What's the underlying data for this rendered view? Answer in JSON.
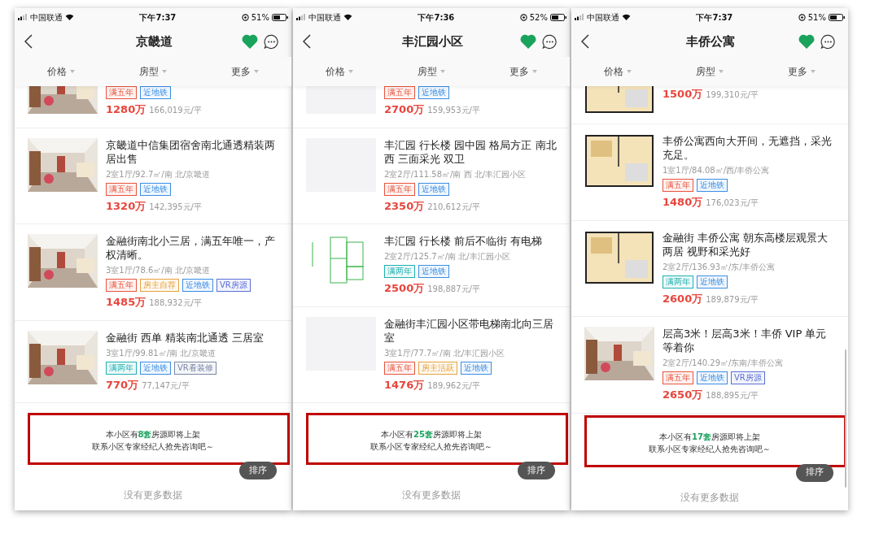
{
  "phones": [
    {
      "status_bar": {
        "carrier": "中国联通",
        "time": "下午7:37",
        "battery": "51%"
      },
      "title": "京畿道",
      "favorited": true,
      "filters": [
        "价格",
        "房型",
        "更多"
      ],
      "scrollbar": false,
      "listings": [
        {
          "partial": true,
          "tags": [
            {
              "label": "满五年",
              "color": "#e8543f"
            },
            {
              "label": "近地铁",
              "color": "#3a8ee6"
            }
          ],
          "price": "1280万",
          "unit_price": "166,019元/平"
        },
        {
          "partial": false,
          "title": "京畿道中信集团宿舍南北通透精装两居出售",
          "spec": "2室1厅/92.7㎡/南 北/京畿道",
          "tags": [
            {
              "label": "满五年",
              "color": "#e8543f"
            },
            {
              "label": "近地铁",
              "color": "#3a8ee6"
            }
          ],
          "price": "1320万",
          "unit_price": "142,395元/平"
        },
        {
          "partial": false,
          "title": "金融街南北小三居，满五年唯一，产权清晰。",
          "spec": "3室1厅/78.6㎡/南 北/京畿道",
          "tags": [
            {
              "label": "满五年",
              "color": "#e8543f"
            },
            {
              "label": "房主自荐",
              "color": "#e8a23f"
            },
            {
              "label": "近地铁",
              "color": "#3a8ee6"
            },
            {
              "label": "VR房源",
              "color": "#5b6fd6"
            }
          ],
          "price": "1485万",
          "unit_price": "188,932元/平"
        },
        {
          "partial": false,
          "title": "金融街 西单 精装南北通透 三居室",
          "spec": "3室1厅/99.81㎡/南 北/京畿道",
          "tags": [
            {
              "label": "满两年",
              "color": "#1fb0b0"
            },
            {
              "label": "近地铁",
              "color": "#3a8ee6"
            },
            {
              "label": "VR看装修",
              "color": "#7a86a8"
            }
          ],
          "price": "770万",
          "unit_price": "77,147元/平"
        }
      ],
      "promo": {
        "prefix": "本小区有",
        "count": "8套",
        "suffix": "房源即将上架",
        "line2": "联系小区专家经纪人抢先咨询吧～"
      },
      "sort_button": "排序",
      "footer": "没有更多数据"
    },
    {
      "status_bar": {
        "carrier": "中国联通",
        "time": "下午7:36",
        "battery": "52%"
      },
      "title": "丰汇园小区",
      "favorited": true,
      "filters": [
        "价格",
        "房型",
        "更多"
      ],
      "scrollbar": false,
      "listings": [
        {
          "partial": true,
          "kind": "placeholder",
          "tags": [
            {
              "label": "满五年",
              "color": "#e8543f"
            },
            {
              "label": "近地铁",
              "color": "#3a8ee6"
            }
          ],
          "price": "2700万",
          "unit_price": "159,953元/平"
        },
        {
          "partial": false,
          "kind": "placeholder",
          "title": "丰汇园 行长楼 园中园 格局方正 南北西 三面采光 双卫",
          "spec": "2室2厅/111.58㎡/南 西 北/丰汇园小区",
          "tags": [
            {
              "label": "满五年",
              "color": "#e8543f"
            },
            {
              "label": "近地铁",
              "color": "#3a8ee6"
            }
          ],
          "price": "2350万",
          "unit_price": "210,612元/平"
        },
        {
          "partial": false,
          "kind": "floorplan",
          "title": "丰汇园 行长楼 前后不临街 有电梯",
          "spec": "2室2厅/125.7㎡/南 北/丰汇园小区",
          "tags": [
            {
              "label": "满两年",
              "color": "#1fb0b0"
            },
            {
              "label": "近地铁",
              "color": "#3a8ee6"
            }
          ],
          "price": "2500万",
          "unit_price": "198,887元/平"
        },
        {
          "partial": false,
          "kind": "placeholder",
          "title": "金融街丰汇园小区带电梯南北向三居室",
          "spec": "3室1厅/77.7㎡/南 北/丰汇园小区",
          "tags": [
            {
              "label": "满五年",
              "color": "#e8543f"
            },
            {
              "label": "房主活跃",
              "color": "#e8a23f"
            },
            {
              "label": "近地铁",
              "color": "#3a8ee6"
            }
          ],
          "price": "1476万",
          "unit_price": "189,962元/平"
        }
      ],
      "promo": {
        "prefix": "本小区有",
        "count": "25套",
        "suffix": "房源即将上架",
        "line2": "联系小区专家经纪人抢先咨询吧～"
      },
      "sort_button": "排序",
      "footer": "没有更多数据"
    },
    {
      "status_bar": {
        "carrier": "中国联通",
        "time": "下午7:37",
        "battery": "51%"
      },
      "title": "丰侨公寓",
      "favorited": true,
      "filters": [
        "价格",
        "房型",
        "更多"
      ],
      "scrollbar": true,
      "listings": [
        {
          "partial": true,
          "kind": "colorplan",
          "price": "1500万",
          "unit_price": "199,310元/平"
        },
        {
          "partial": false,
          "kind": "colorplan",
          "title": "丰侨公寓西向大开间，无遮挡，采光充足。",
          "spec": "1室1厅/84.08㎡/西/丰侨公寓",
          "tags": [
            {
              "label": "满五年",
              "color": "#e8543f"
            },
            {
              "label": "近地铁",
              "color": "#3a8ee6"
            }
          ],
          "price": "1480万",
          "unit_price": "176,023元/平"
        },
        {
          "partial": false,
          "kind": "colorplan",
          "title": "金融街 丰侨公寓 朝东高楼层观景大两居 视野和采光好",
          "spec": "2室2厅/136.93㎡/东/丰侨公寓",
          "tags": [
            {
              "label": "满两年",
              "color": "#1fb0b0"
            },
            {
              "label": "近地铁",
              "color": "#3a8ee6"
            }
          ],
          "price": "2600万",
          "unit_price": "189,879元/平"
        },
        {
          "partial": false,
          "title": "层高3米！层高3米！丰侨 VIP 单元等着你",
          "spec": "2室2厅/140.29㎡/东南/丰侨公寓",
          "tags": [
            {
              "label": "满五年",
              "color": "#e8543f"
            },
            {
              "label": "近地铁",
              "color": "#3a8ee6"
            },
            {
              "label": "VR房源",
              "color": "#5b6fd6"
            }
          ],
          "price": "2650万",
          "unit_price": "188,895元/平"
        }
      ],
      "promo": {
        "prefix": "本小区有",
        "count": "17套",
        "suffix": "房源即将上架",
        "line2": "联系小区专家经纪人抢先咨询吧～"
      },
      "sort_button": "排序",
      "footer": "没有更多数据"
    }
  ]
}
